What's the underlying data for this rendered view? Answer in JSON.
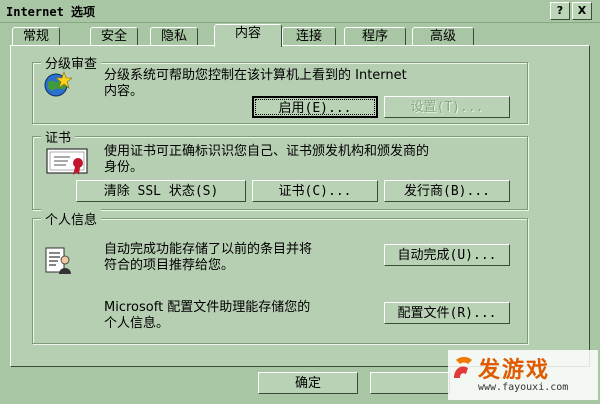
{
  "window": {
    "title": "Internet 选项",
    "help_btn": "?",
    "close_btn": "X"
  },
  "tabs": [
    {
      "label": "常规"
    },
    {
      "label": "安全"
    },
    {
      "label": "隐私"
    },
    {
      "label": "内容"
    },
    {
      "label": "连接"
    },
    {
      "label": "程序"
    },
    {
      "label": "高级"
    }
  ],
  "active_tab": "内容",
  "rating": {
    "title": "分级审查",
    "line1": "分级系统可帮助您控制在该计算机上看到的 Internet",
    "line2": "内容。",
    "enable_btn": "启用(E)...",
    "settings_btn": "设置(T)..."
  },
  "cert": {
    "title": "证书",
    "line1": "使用证书可正确标识识您自己、证书颁发机构和颁发商的",
    "line2": "身份。",
    "clear_ssl_btn": "清除 SSL 状态(S)",
    "cert_btn": "证书(C)...",
    "publisher_btn": "发行商(B)..."
  },
  "personal": {
    "title": "个人信息",
    "auto_line1": "自动完成功能存储了以前的条目并将",
    "auto_line2": "符合的项目推荐给您。",
    "auto_btn": "自动完成(U)...",
    "profile_line1": "Microsoft 配置文件助理能存储您的",
    "profile_line2": "个人信息。",
    "profile_btn": "配置文件(R)..."
  },
  "footer": {
    "ok_btn": "确定"
  },
  "watermark": {
    "logo": "发游戏",
    "url": "www.fayouxi.com"
  }
}
